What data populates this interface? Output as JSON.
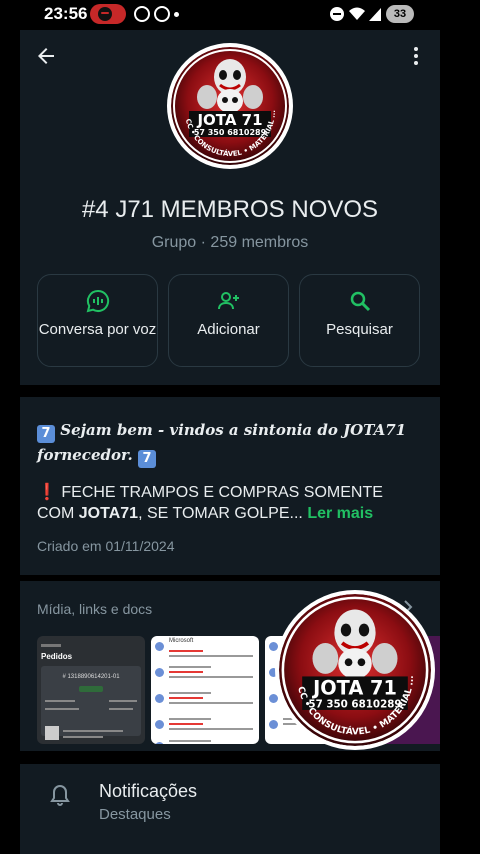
{
  "status_bar": {
    "time": "23:56",
    "battery": "33",
    "icons": [
      "spotify-icon",
      "whatsapp-icon",
      "whatsapp-icon",
      "notification-dot",
      "do-not-disturb-icon",
      "wifi-icon",
      "signal-icon",
      "battery-icon"
    ]
  },
  "header": {
    "back_icon": "arrow-left-icon",
    "menu_icon": "more-vertical-icon",
    "avatar_logo_text": "JOTA 71",
    "avatar_phone": "57 350 6810289",
    "avatar_ring_text": "CC • CONSULTÁVEL • MATERIAL ...",
    "group_title": "#4 J71 MEMBROS NOVOS",
    "group_subtitle": "Grupo · 259 membros"
  },
  "actions": [
    {
      "label": "Conversa por voz",
      "icon": "voice-chat-icon"
    },
    {
      "label": "Adicionar",
      "icon": "add-person-icon"
    },
    {
      "label": "Pesquisar",
      "icon": "search-icon"
    }
  ],
  "description": {
    "emoji": "7",
    "gothic_line_1": "Sejam bem - vindos a sintonia do JOTA71",
    "gothic_line_2": "fornecedor.",
    "alert_icon": "❗",
    "body_prefix": "FECHE TRAMPOS E COMPRAS SOMENTE COM ",
    "body_bold": "JOTA71",
    "body_suffix": ", SE TOMAR GOLPE...",
    "read_more": "Ler mais",
    "created": "Criado em 01/11/2024"
  },
  "media": {
    "title": "Mídia, links e docs",
    "chevron_icon": "chevron-right-icon",
    "thumb_orders_title": "Pedidos",
    "thumb_orders_order": "# 1318890614201-01",
    "thumb_mail_sender": "Microsoft"
  },
  "notifications": {
    "icon": "bell-icon",
    "title": "Notificações",
    "subtitle": "Destaques"
  },
  "colors": {
    "background": "#000000",
    "card": "#121b22",
    "accent_green": "#21c063",
    "muted_text": "#8696a0",
    "primary_text": "#e9edef"
  }
}
